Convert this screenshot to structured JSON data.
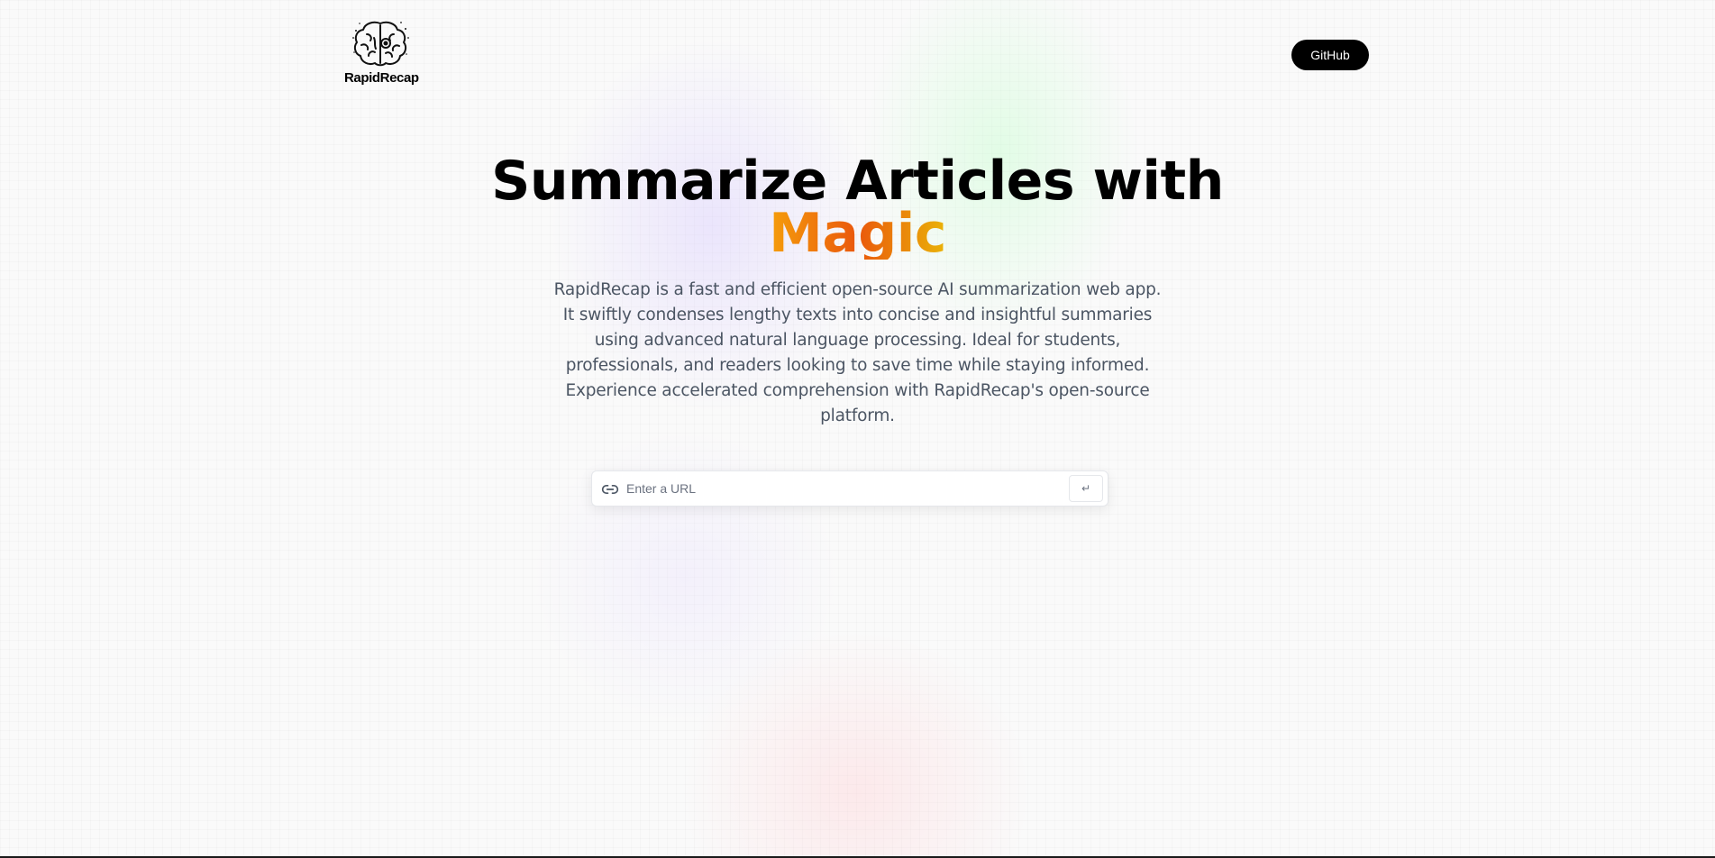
{
  "brand": {
    "name": "RapidRecap",
    "logo_icon": "brain-icon"
  },
  "nav": {
    "github_label": "GitHub"
  },
  "hero": {
    "headline_line1": "Summarize Articles with",
    "headline_highlight": "Magic",
    "description": "RapidRecap is a fast and efficient open-source AI summarization web app. It swiftly condenses lengthy texts into concise and insightful summaries using advanced natural language processing. Ideal for students, professionals, and readers looking to save time while staying informed. Experience accelerated comprehension with RapidRecap's open-source platform."
  },
  "url_form": {
    "placeholder": "Enter a URL",
    "value": "",
    "link_icon": "link-icon",
    "submit_label": "↵"
  },
  "colors": {
    "accent_gradient": [
      "#f59e0b",
      "#ea580c",
      "#eab308"
    ],
    "button_bg": "#000000",
    "text_muted": "#4b5563"
  }
}
